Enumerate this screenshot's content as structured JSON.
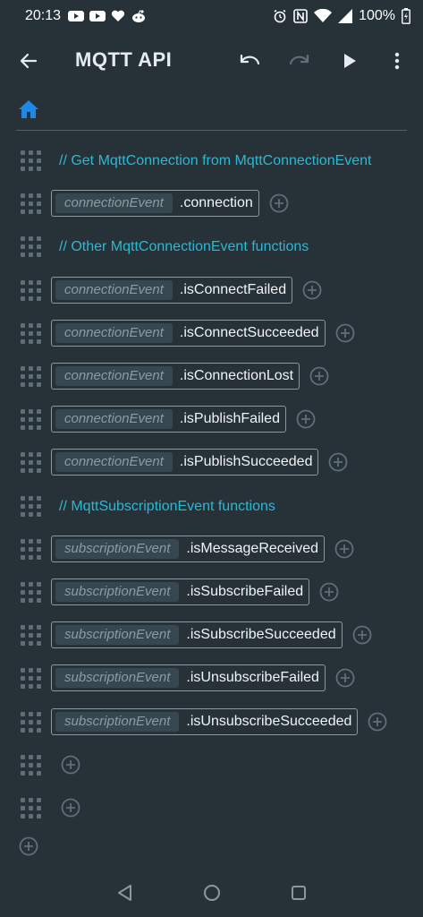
{
  "status": {
    "time": "20:13",
    "battery": "100%",
    "left_icons": [
      "youtube-icon",
      "youtube-icon",
      "heart-icon",
      "reddit-icon"
    ],
    "right_icons": [
      "alarm-icon",
      "nfc-icon",
      "wifi-icon",
      "signal-icon",
      "battery-icon"
    ]
  },
  "toolbar": {
    "title": "MQTT API",
    "icons": [
      "back-arrow-icon",
      "undo-icon",
      "redo-icon",
      "play-icon",
      "more-vert-icon"
    ]
  },
  "colors": {
    "background": "#263238",
    "comment": "#2bb8d4",
    "param_bg": "#37474f",
    "home_icon": "#1e88e5",
    "muted_icon": "#5f6e78"
  },
  "rows": [
    {
      "type": "comment",
      "text": "// Get MqttConnection from MqttConnectionEvent"
    },
    {
      "type": "block",
      "param": "connectionEvent",
      "method": ".connection"
    },
    {
      "type": "comment",
      "text": "// Other MqttConnectionEvent functions"
    },
    {
      "type": "block",
      "param": "connectionEvent",
      "method": ".isConnectFailed"
    },
    {
      "type": "block",
      "param": "connectionEvent",
      "method": ".isConnectSucceeded"
    },
    {
      "type": "block",
      "param": "connectionEvent",
      "method": ".isConnectionLost"
    },
    {
      "type": "block",
      "param": "connectionEvent",
      "method": ".isPublishFailed"
    },
    {
      "type": "block",
      "param": "connectionEvent",
      "method": ".isPublishSucceeded"
    },
    {
      "type": "comment",
      "text": "// MqttSubscriptionEvent functions"
    },
    {
      "type": "block",
      "param": "subscriptionEvent",
      "method": ".isMessageReceived"
    },
    {
      "type": "block",
      "param": "subscriptionEvent",
      "method": ".isSubscribeFailed"
    },
    {
      "type": "block",
      "param": "subscriptionEvent",
      "method": ".isSubscribeSucceeded"
    },
    {
      "type": "block",
      "param": "subscriptionEvent",
      "method": ".isUnsubscribeFailed"
    },
    {
      "type": "block",
      "param": "subscriptionEvent",
      "method": ".isUnsubscribeSucceeded"
    },
    {
      "type": "empty"
    },
    {
      "type": "empty"
    }
  ],
  "navbar": {
    "icons": [
      "nav-back-icon",
      "nav-home-icon",
      "nav-recents-icon"
    ]
  }
}
